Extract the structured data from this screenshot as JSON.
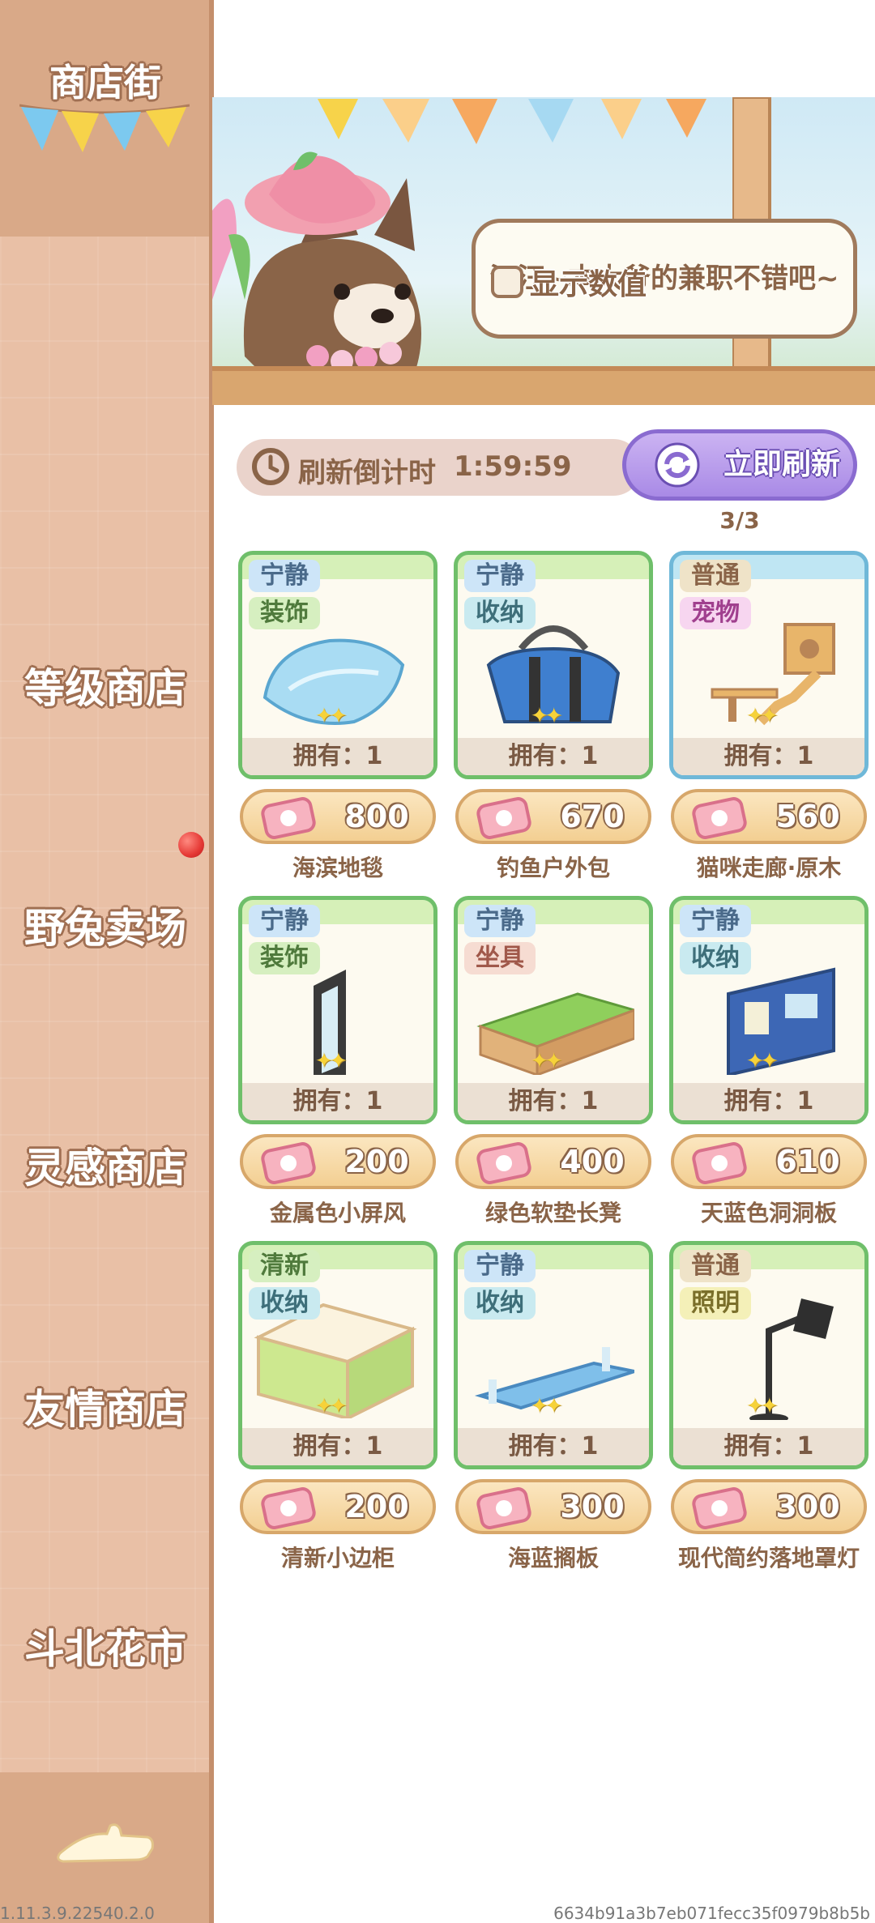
{
  "sidebar": {
    "title": "商店街",
    "items": [
      {
        "label": "等级商店"
      },
      {
        "label": "野兔卖场"
      },
      {
        "label": "灵感商店"
      },
      {
        "label": "友情商店"
      },
      {
        "label": "斗北花市"
      }
    ],
    "notification_dot_color": "#e53935"
  },
  "banner": {
    "speech": "汪汪~本大爷的兼职不错吧~",
    "show_values_label": "显示数值",
    "show_values_checked": false
  },
  "refresh": {
    "label": "刷新倒计时",
    "timer": "1:59:59",
    "button_label": "立即刷新",
    "count": "3/3"
  },
  "items": [
    {
      "mood": "宁静",
      "category": "装饰",
      "owned": "拥有：1",
      "price": "800",
      "name": "海滨地毯"
    },
    {
      "mood": "宁静",
      "category": "收纳",
      "owned": "拥有：1",
      "price": "670",
      "name": "钓鱼户外包"
    },
    {
      "mood": "普通",
      "category": "宠物",
      "owned": "拥有：1",
      "price": "560",
      "name": "猫咪走廊·原木"
    },
    {
      "mood": "宁静",
      "category": "装饰",
      "owned": "拥有：1",
      "price": "200",
      "name": "金属色小屏风"
    },
    {
      "mood": "宁静",
      "category": "坐具",
      "owned": "拥有：1",
      "price": "400",
      "name": "绿色软垫长凳"
    },
    {
      "mood": "宁静",
      "category": "收纳",
      "owned": "拥有：1",
      "price": "610",
      "name": "天蓝色洞洞板"
    },
    {
      "mood": "清新",
      "category": "收纳",
      "owned": "拥有：1",
      "price": "200",
      "name": "清新小边柜"
    },
    {
      "mood": "宁静",
      "category": "收纳",
      "owned": "拥有：1",
      "price": "300",
      "name": "海蓝搁板"
    },
    {
      "mood": "普通",
      "category": "照明",
      "owned": "拥有：1",
      "price": "300",
      "name": "现代简约落地罩灯"
    }
  ],
  "footer": {
    "version": "1.11.3.9.22540.2.0",
    "build_hash": "6634b91a3b7eb071fecc35f0979b8b5b"
  }
}
